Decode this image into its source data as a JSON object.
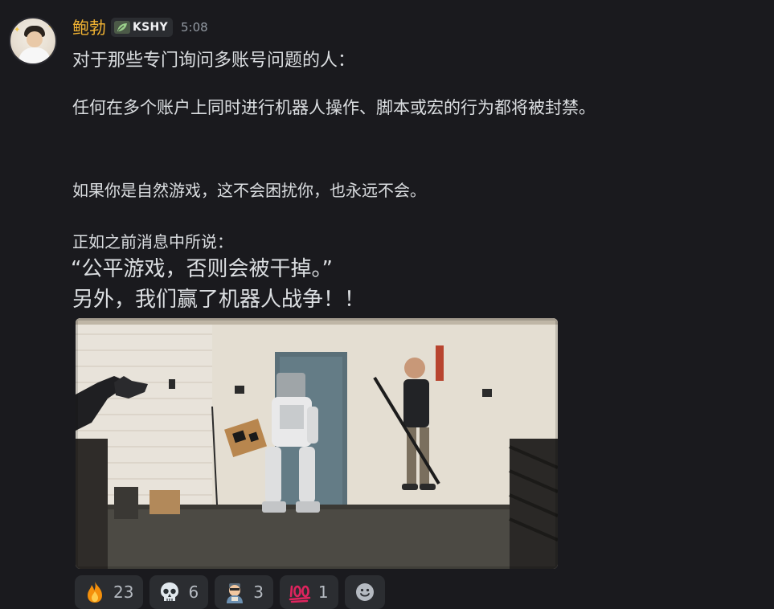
{
  "message": {
    "author": "鲍勃",
    "badge": "KSHY",
    "timestamp": "5:08",
    "lines": [
      "对于那些专门询问多账号问题的人：",
      "任何在多个账户上同时进行机器人操作、脚本或宏的行为都将被封禁。",
      "如果你是自然游戏，这不会困扰你，也永远不会。",
      "正如之前消息中所说：",
      "“公平游戏，否则会被干掉。”",
      "另外，我们赢了机器人战争！！"
    ]
  },
  "reactions": [
    {
      "icon": "fire-emoji-icon",
      "count": "23"
    },
    {
      "icon": "skull-emoji-icon",
      "count": "6"
    },
    {
      "icon": "custom-character-emoji-icon",
      "count": "3"
    },
    {
      "icon": "hundred-points-emoji-icon",
      "count": "1"
    }
  ],
  "colors": {
    "background": "#1a1a1e",
    "username": "#f0b232",
    "text": "#dbdee1",
    "timestamp": "#949ba4",
    "reaction_bg": "#2b2d31"
  }
}
